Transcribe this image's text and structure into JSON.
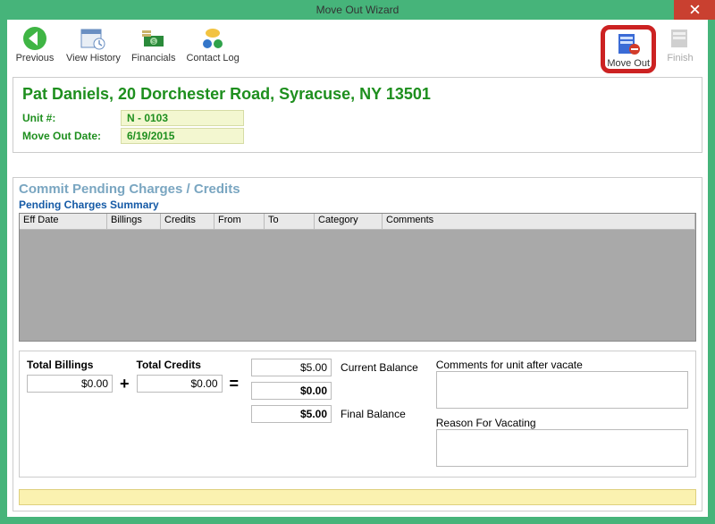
{
  "window": {
    "title": "Move Out Wizard"
  },
  "toolbar": {
    "previous": "Previous",
    "view_history": "View History",
    "financials": "Financials",
    "contact_log": "Contact Log",
    "move_out": "Move Out",
    "finish": "Finish"
  },
  "header": {
    "title": "Pat Daniels, 20 Dorchester Road, Syracuse, NY  13501",
    "unit_label": "Unit #:",
    "unit_value": "N - 0103",
    "date_label": "Move Out Date:",
    "date_value": "6/19/2015"
  },
  "section": {
    "title": "Commit Pending Charges / Credits",
    "subtitle": "Pending Charges Summary"
  },
  "grid": {
    "columns": [
      "Eff Date",
      "Billings",
      "Credits",
      "From",
      "To",
      "Category",
      "Comments"
    ]
  },
  "totals": {
    "billings_label": "Total Billings",
    "billings_value": "$0.00",
    "credits_label": "Total Credits",
    "credits_value": "$0.00",
    "current_balance_label": "Current Balance",
    "current_balance_value": "$5.00",
    "net_value": "$0.00",
    "final_balance_label": "Final Balance",
    "final_balance_value": "$5.00",
    "comments_label": "Comments for unit after vacate",
    "reason_label": "Reason For Vacating"
  }
}
